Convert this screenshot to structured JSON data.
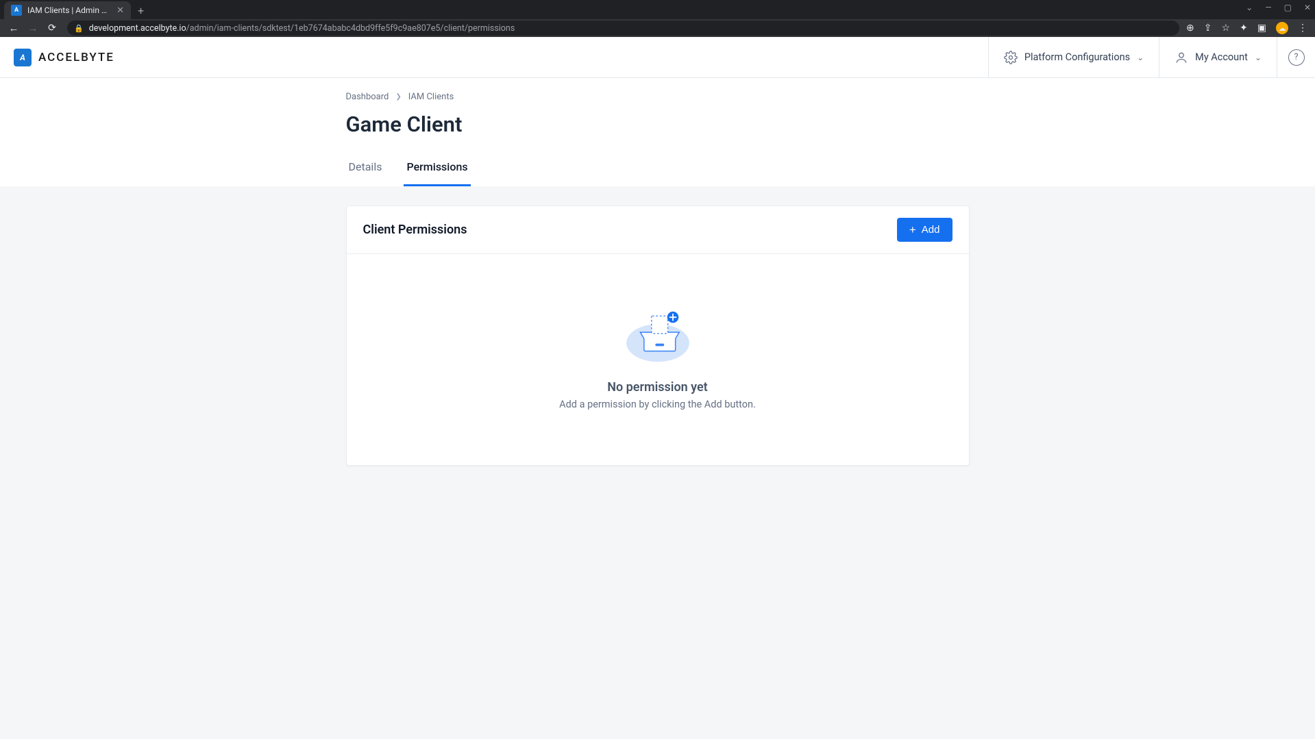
{
  "browser": {
    "tab_title": "IAM Clients | Admin Portal",
    "url_host": "development.accelbyte.io",
    "url_path": "/admin/iam-clients/sdktest/1eb7674ababc4dbd9ffe5f9c9ae807e5/client/permissions"
  },
  "header": {
    "logo_text": "ACCELBYTE",
    "platform_config_label": "Platform Configurations",
    "my_account_label": "My Account"
  },
  "breadcrumb": {
    "items": [
      "Dashboard",
      "IAM Clients"
    ]
  },
  "page": {
    "title": "Game Client",
    "tabs": {
      "details": "Details",
      "permissions": "Permissions"
    }
  },
  "card": {
    "title": "Client Permissions",
    "add_label": "Add"
  },
  "empty": {
    "title": "No permission yet",
    "subtitle": "Add a permission by clicking the Add button."
  }
}
